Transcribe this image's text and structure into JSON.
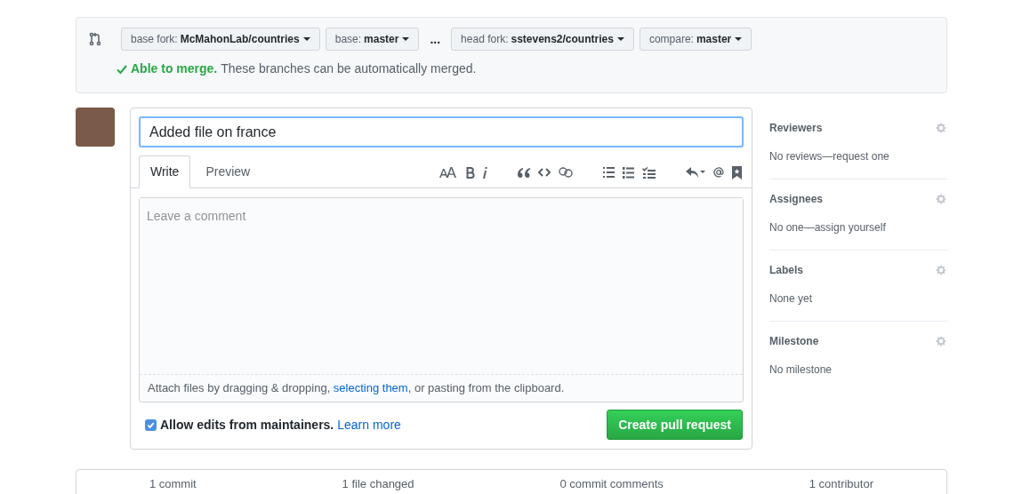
{
  "compare": {
    "base_fork": {
      "label": "base fork:",
      "value": "McMahonLab/countries"
    },
    "base": {
      "label": "base:",
      "value": "master"
    },
    "ellipsis": "...",
    "head_fork": {
      "label": "head fork:",
      "value": "sstevens2/countries"
    },
    "compare_branch": {
      "label": "compare:",
      "value": "master"
    },
    "merge_status": {
      "able": true,
      "title": "Able to merge.",
      "message": "These branches can be automatically merged."
    }
  },
  "form": {
    "title_value": "Added file on france",
    "tabs": [
      {
        "label": "Write",
        "selected": true
      },
      {
        "label": "Preview",
        "selected": false
      }
    ],
    "comment_placeholder": "Leave a comment",
    "attach": {
      "before": "Attach files by dragging & dropping, ",
      "link": "selecting them",
      "after": ", or pasting from the clipboard."
    },
    "allow_edits": {
      "checked": true,
      "label": "Allow edits from maintainers.",
      "link": "Learn more"
    },
    "submit": "Create pull request"
  },
  "sidebar": [
    {
      "heading": "Reviewers",
      "value": "No reviews—request one"
    },
    {
      "heading": "Assignees",
      "value": "No one—assign yourself"
    },
    {
      "heading": "Labels",
      "value": "None yet"
    },
    {
      "heading": "Milestone",
      "value": "No milestone"
    }
  ],
  "summary": [
    "1 commit",
    "1 file changed",
    "0 commit comments",
    "1 contributor"
  ]
}
